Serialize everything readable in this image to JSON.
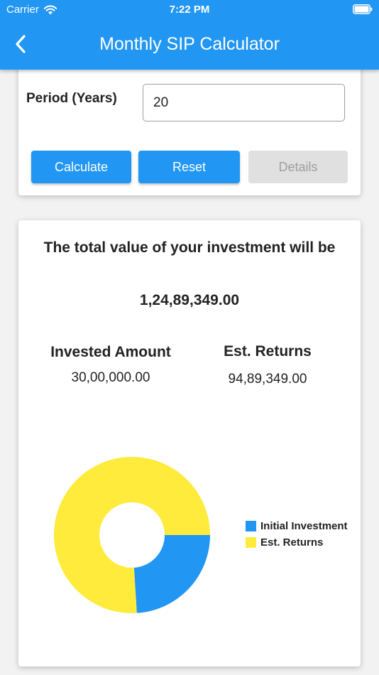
{
  "status_bar": {
    "carrier": "Carrier",
    "time": "7:22 PM",
    "icons": [
      "wifi-icon",
      "battery-icon"
    ]
  },
  "header": {
    "title": "Monthly SIP Calculator",
    "back_icon": "chevron-left-icon"
  },
  "form": {
    "period_label": "Period (Years)",
    "period_value": "20"
  },
  "buttons": {
    "calculate": "Calculate",
    "reset": "Reset",
    "details": "Details"
  },
  "result": {
    "heading": "The total value of your investment will be",
    "total": "1,24,89,349.00",
    "invested_label": "Invested Amount",
    "invested_value": "30,00,000.00",
    "returns_label": "Est. Returns",
    "returns_value": "94,89,349.00"
  },
  "colors": {
    "primary": "#2196f3",
    "investment": "#2196f3",
    "returns": "#ffeb3b"
  },
  "chart_data": {
    "type": "pie",
    "categories": [
      "Initial Investment",
      "Est. Returns"
    ],
    "values": [
      3000000,
      9489349
    ],
    "colors": [
      "#2196f3",
      "#ffeb3b"
    ],
    "legend": "right",
    "donut": true
  }
}
